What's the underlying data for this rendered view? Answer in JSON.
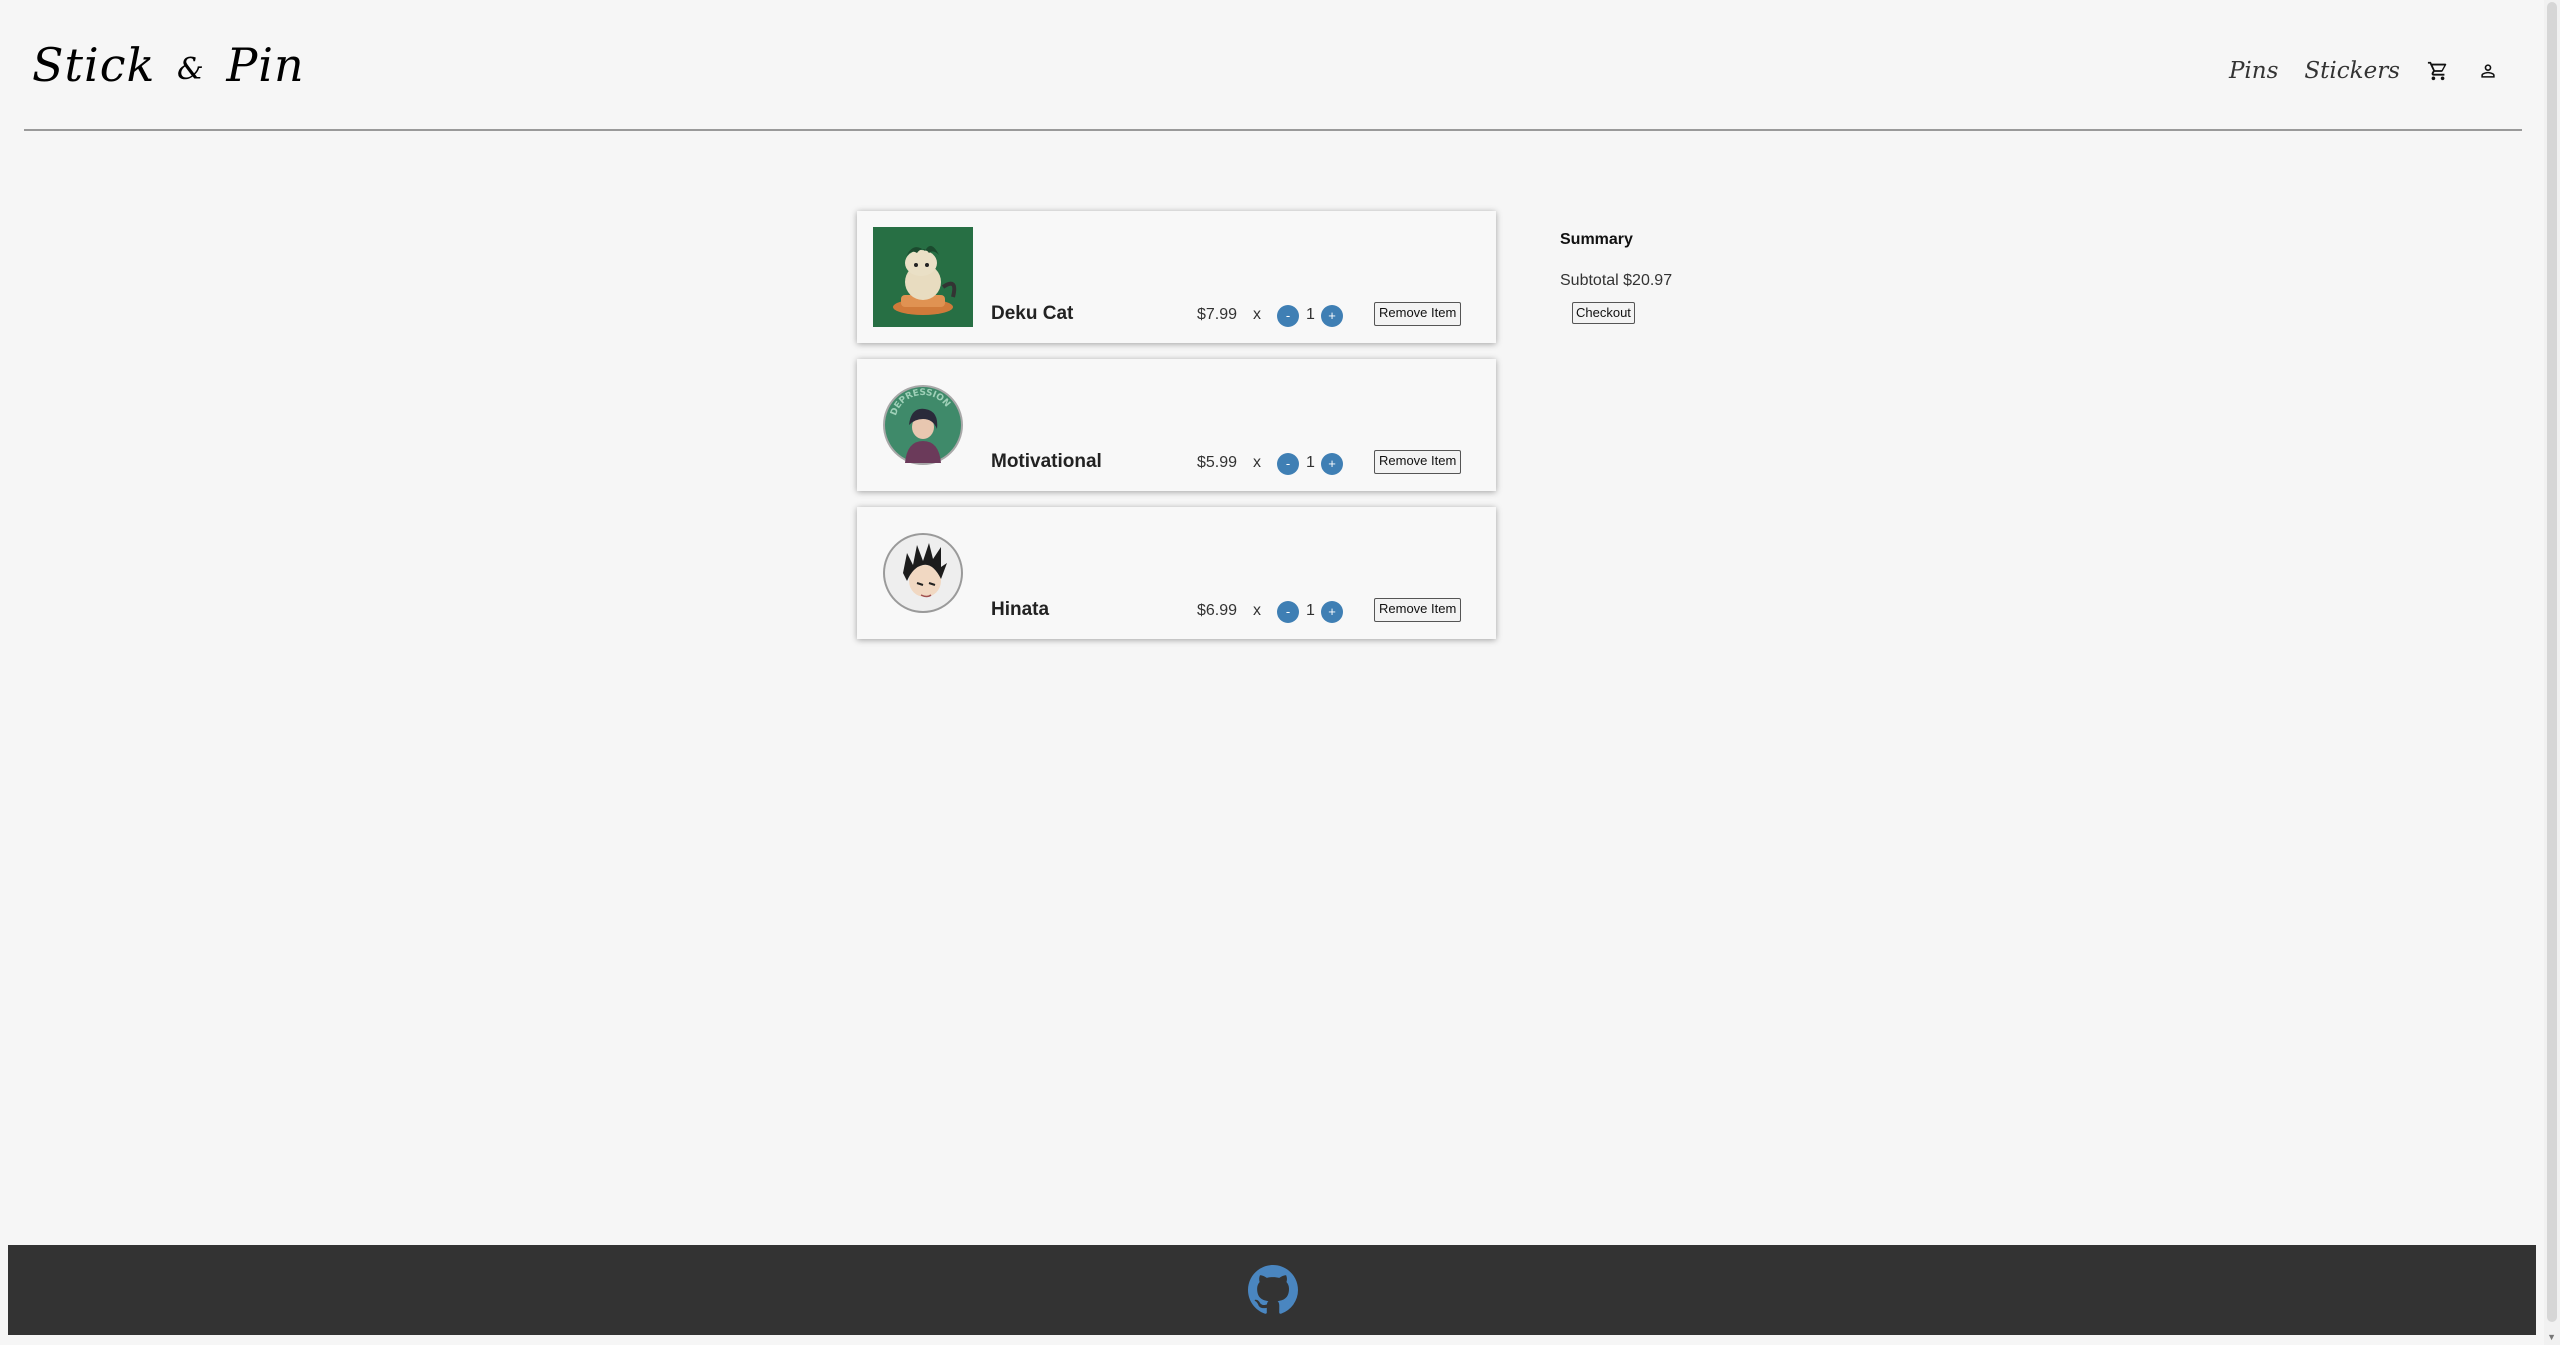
{
  "header": {
    "logo_main": "Stick",
    "logo_amp": "&",
    "logo_end": "Pin",
    "nav": {
      "pins": "Pins",
      "stickers": "Stickers",
      "cart_icon": "cart-icon",
      "account_icon": "person-icon"
    }
  },
  "cart": {
    "items": [
      {
        "name": "Deku Cat",
        "price": "$7.99",
        "times": "x",
        "qty": "1",
        "minus": "-",
        "plus": "+",
        "remove": "Remove Item"
      },
      {
        "name": "Motivational",
        "price": "$5.99",
        "times": "x",
        "qty": "1",
        "minus": "-",
        "plus": "+",
        "remove": "Remove Item"
      },
      {
        "name": "Hinata",
        "price": "$6.99",
        "times": "x",
        "qty": "1",
        "minus": "-",
        "plus": "+",
        "remove": "Remove Item"
      }
    ],
    "motivational_pin_text": "DEPRESSION"
  },
  "summary": {
    "title": "Summary",
    "subtotal": "Subtotal $20.97",
    "checkout": "Checkout"
  },
  "footer": {
    "icon": "github-icon"
  },
  "colors": {
    "accent": "#3f7fb4",
    "footer_bg": "#333333",
    "page_bg": "#f6f6f6"
  }
}
